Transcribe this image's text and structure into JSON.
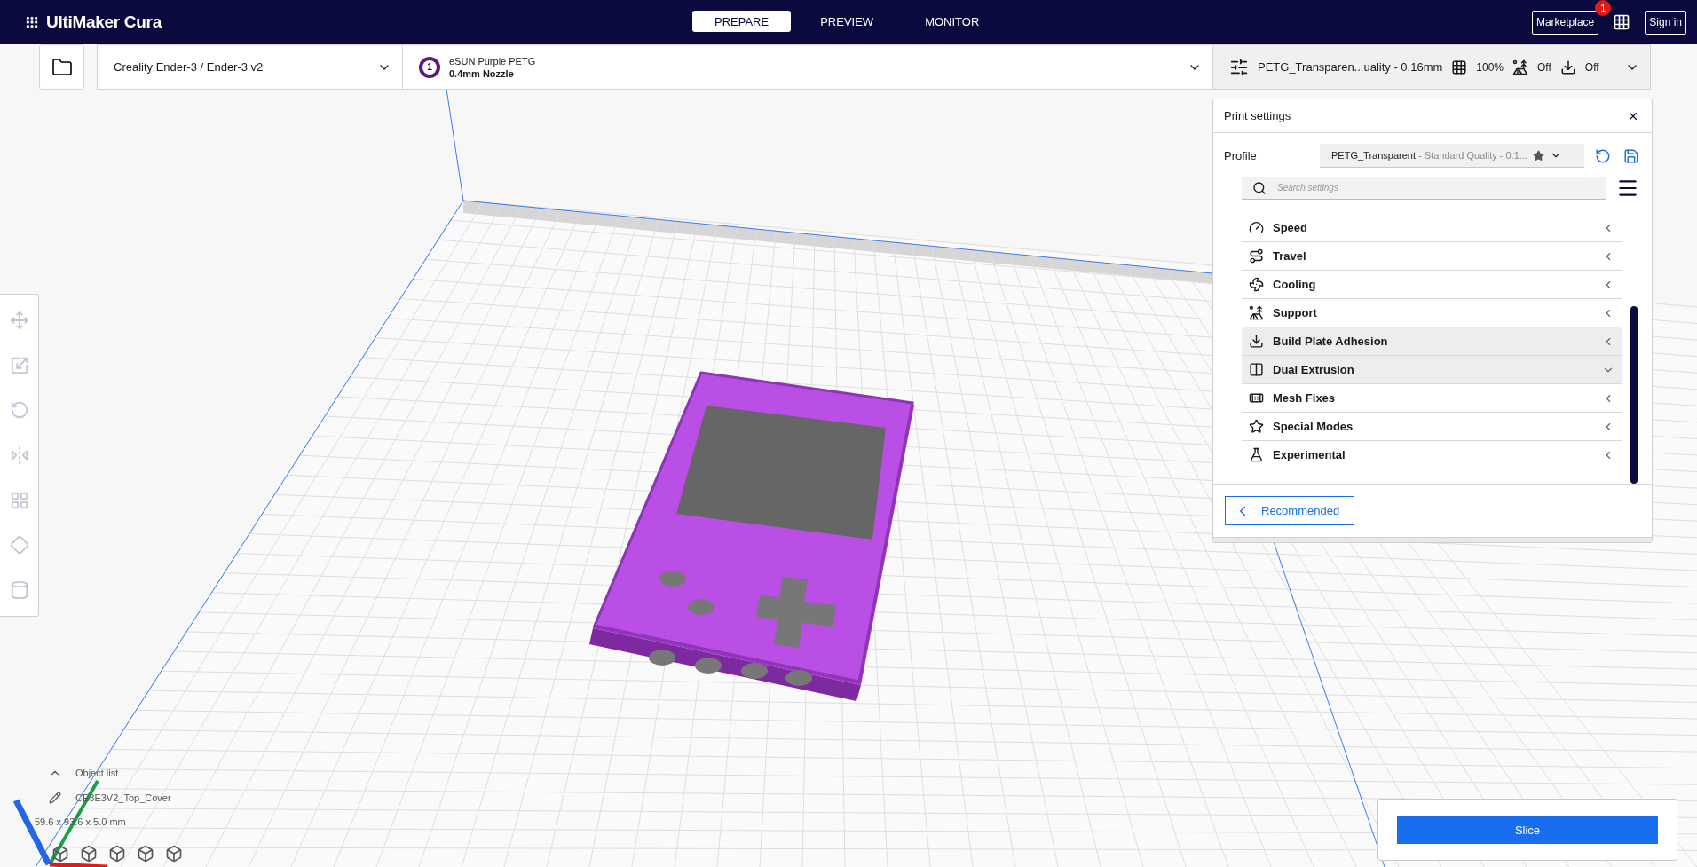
{
  "app": {
    "title": "UltiMaker Cura"
  },
  "stages": [
    {
      "label": "PREPARE",
      "selected": true
    },
    {
      "label": "PREVIEW",
      "selected": false
    },
    {
      "label": "MONITOR",
      "selected": false
    }
  ],
  "header_actions": {
    "marketplace": "Marketplace",
    "marketplace_badge": "1",
    "sign_in": "Sign in"
  },
  "printer": {
    "name": "Creality Ender-3 / Ender-3 v2"
  },
  "extruder": {
    "number": "1",
    "material": "eSUN Purple PETG",
    "nozzle": "0.4mm Nozzle"
  },
  "print_summary": {
    "profile": "PETG_Transparen...uality - 0.16mm",
    "infill": "100%",
    "support": "Off",
    "adhesion": "Off"
  },
  "print_settings": {
    "title": "Print settings",
    "profile_label": "Profile",
    "profile_name": "PETG_Transparent",
    "profile_detail": "- Standard Quality - 0.1...",
    "search_placeholder": "Search settings",
    "categories": [
      {
        "label": "Speed",
        "expanded": false,
        "highlighted": false
      },
      {
        "label": "Travel",
        "expanded": false,
        "highlighted": false
      },
      {
        "label": "Cooling",
        "expanded": false,
        "highlighted": false
      },
      {
        "label": "Support",
        "expanded": false,
        "highlighted": false
      },
      {
        "label": "Build Plate Adhesion",
        "expanded": false,
        "highlighted": true
      },
      {
        "label": "Dual Extrusion",
        "expanded": true,
        "highlighted": true
      },
      {
        "label": "Mesh Fixes",
        "expanded": false,
        "highlighted": false
      },
      {
        "label": "Special Modes",
        "expanded": false,
        "highlighted": false
      },
      {
        "label": "Experimental",
        "expanded": false,
        "highlighted": false
      }
    ],
    "recommended": "Recommended"
  },
  "tools": [
    {
      "disabled": true
    },
    {
      "disabled": true
    },
    {
      "disabled": true
    },
    {
      "disabled": true
    },
    {
      "disabled": true
    },
    {
      "disabled": true
    },
    {
      "disabled": true
    }
  ],
  "object_list": {
    "label": "Object list",
    "object_name": "CE3E3V2_Top_Cover",
    "dimensions": "59.6 x 93.6 x 5.0 mm"
  },
  "slice": {
    "label": "Slice"
  }
}
